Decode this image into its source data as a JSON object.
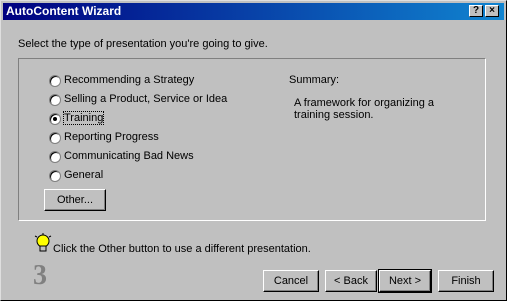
{
  "window": {
    "title": "AutoContent Wizard",
    "help_button": "?",
    "close_button": "×"
  },
  "prompt": "Select the type of presentation you're going to give.",
  "options": [
    {
      "label": "Recommending a Strategy",
      "selected": false
    },
    {
      "label": "Selling a Product, Service or Idea",
      "selected": false
    },
    {
      "label": "Training",
      "selected": true
    },
    {
      "label": "Reporting Progress",
      "selected": false
    },
    {
      "label": "Communicating Bad News",
      "selected": false
    },
    {
      "label": "General",
      "selected": false
    }
  ],
  "other_button": "Other...",
  "summary": {
    "label": "Summary:",
    "text": "A framework for organizing a training session."
  },
  "tip": "Click the Other button to use a different presentation.",
  "step_number": "3",
  "buttons": {
    "cancel": "Cancel",
    "back": "< Back",
    "next": "Next >",
    "finish": "Finish"
  },
  "icons": {
    "tip": "lightbulb-icon"
  }
}
